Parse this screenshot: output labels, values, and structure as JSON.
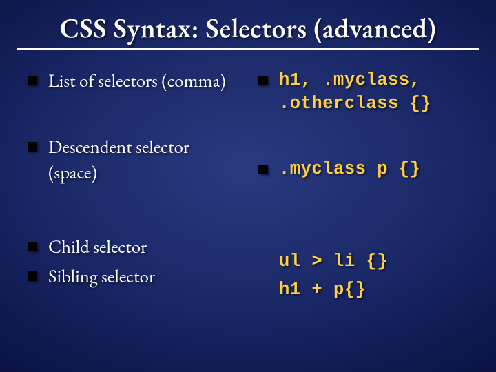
{
  "title": "CSS Syntax: Selectors (advanced)",
  "left": {
    "i0": "List of selectors (comma)",
    "i1": "Descendent selector (space)",
    "i2": "Child selector",
    "i3": "Sibling selector"
  },
  "right": {
    "c0": "h1, .myclass, .otherclass {}",
    "c1": ".myclass p {}",
    "c2": "ul > li {}",
    "c3": "h1 + p{}"
  }
}
